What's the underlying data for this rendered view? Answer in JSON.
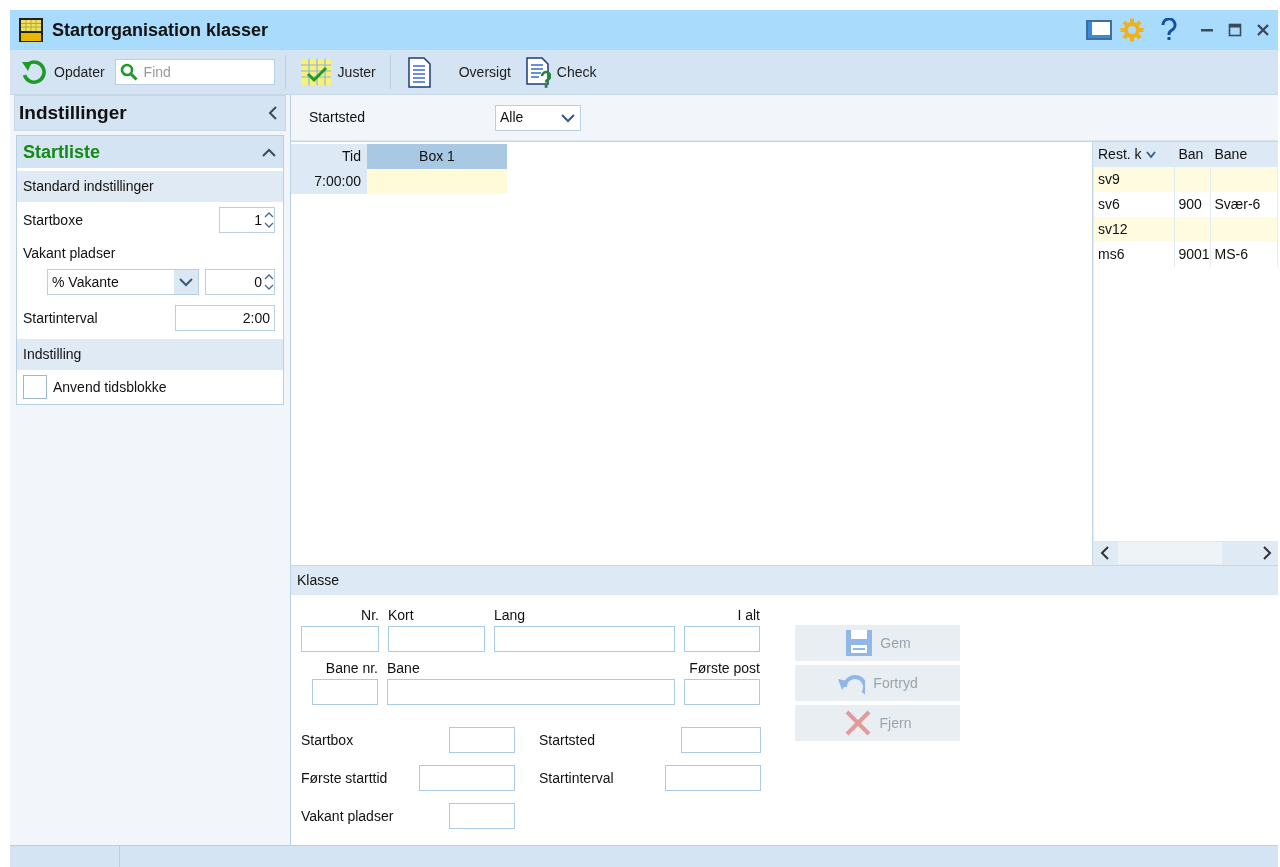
{
  "window": {
    "title": "Startorganisation klasser"
  },
  "toolbar": {
    "refresh": "Opdater",
    "search_placeholder": "Find",
    "buttons": [
      {
        "kind": "adjust",
        "label": "Juster"
      },
      {
        "kind": "overview",
        "label": "Oversigt"
      },
      {
        "kind": "check",
        "label": "Check"
      }
    ]
  },
  "settings_panel": {
    "title": "Indstillinger",
    "section": {
      "title": "Startliste",
      "expanded": true,
      "groups": [
        {
          "title": "Standard indstillinger",
          "items": [
            {
              "kind": "spin",
              "label": "Startboxe",
              "value": "1"
            },
            {
              "kind": "label",
              "label": "Vakant pladser"
            },
            {
              "kind": "select_spin",
              "option": "% Vakante",
              "value": "0"
            },
            {
              "kind": "text",
              "label": "Startinterval",
              "value": "2:00"
            }
          ]
        },
        {
          "title": "Indstilling",
          "items": [
            {
              "kind": "checkbox",
              "label": "Anvend tidsblokke",
              "checked": false
            }
          ]
        }
      ]
    }
  },
  "filter": {
    "label": "Startsted",
    "value": "Alle"
  },
  "start_grid": {
    "columns": [
      "Tid",
      "Box 1"
    ],
    "rows": [
      {
        "time": "7:00:00"
      }
    ]
  },
  "class_list": {
    "columns": [
      "Rest. k",
      "Ban",
      "Bane"
    ],
    "rows": [
      {
        "cells": [
          "sv9"
        ],
        "highlighted": true
      },
      {
        "cells": [
          "sv6",
          "900",
          "Svær-6"
        ],
        "highlighted": false
      },
      {
        "cells": [
          "sv12"
        ],
        "highlighted": true
      },
      {
        "cells": [
          "ms6",
          "9001",
          "MS-6"
        ],
        "highlighted": false
      }
    ]
  },
  "class_form": {
    "title": "Klasse",
    "top_rows": [
      [
        {
          "label": "Nr."
        },
        {
          "label": "Kort"
        },
        {
          "label": "Lang"
        },
        {
          "label": "I alt"
        }
      ],
      [
        {
          "label": "Bane nr."
        },
        {
          "label": "Bane"
        },
        {
          "label": "Første post"
        }
      ]
    ],
    "fields": [
      {
        "label": "Startbox"
      },
      {
        "label": "Startsted"
      },
      {
        "label": "Første starttid"
      },
      {
        "label": "Startinterval"
      },
      {
        "label": "Vakant pladser"
      }
    ],
    "buttons": [
      {
        "kind": "save",
        "label": "Gem",
        "disabled": true
      },
      {
        "kind": "undo",
        "label": "Fortryd",
        "disabled": true
      },
      {
        "kind": "delete",
        "label": "Fjern",
        "disabled": true
      }
    ]
  }
}
